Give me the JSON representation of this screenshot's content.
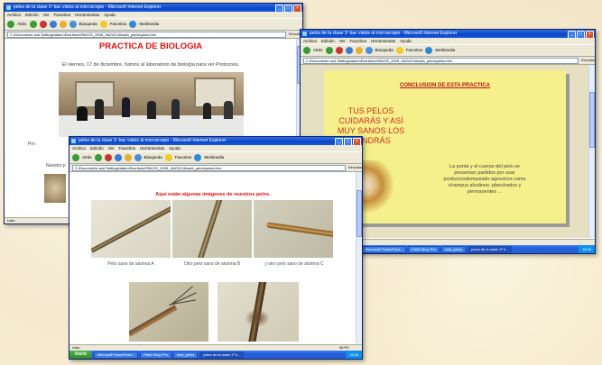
{
  "menu_items": [
    "Archivo",
    "Edición",
    "Ver",
    "Favoritos",
    "Herramientas",
    "Ayuda"
  ],
  "toolbar": {
    "back": "Atrás",
    "search": "Búsqueda",
    "favorites": "Favoritos",
    "multimedia": "Multimedia",
    "links": "Vínculos"
  },
  "win1": {
    "title": "pelos de la clase 1º bac vistos al microscopio - Microsoft Internet Explorer",
    "address": "C:\\Documents and Settings\\dalen\\Escritorio\\PAKOS_2005_VAZ\\SCIA\\web_pelos\\pelos.htm",
    "heading": "PRACTICA DE BIOLOGIA",
    "intro": "El viernes, 17 de diciembre, fuimos al laboratorio de biologia para ver Protozoos.",
    "para_fragment": "Pro",
    "para_fragment2": "Nuestro p",
    "status": "Listo"
  },
  "win2": {
    "title": "pelos de la clase 1º bac vistos al microscopio - Microsoft Internet Explorer",
    "address": "C:\\Documents and Settings\\dalen\\Escritorio\\PAKOS_2005_VAZ\\SCIA\\web_pelos\\pelos.htm",
    "section_title": "CONCLUSION DE ESTA PRACTICA",
    "big_text": "TUS PELOS CUIDARÁS Y ASÍ MUY SANOS LOS TENDRÁS",
    "body_text": "La punta y el cuerpo del pelo se presentan partidos por usar productosdemasiado agresivos como champus alcalinos. planchados y permanentes ...",
    "status": "Mi PC",
    "tasks": [
      "Microsoft PowerPoint...",
      "Paint Shop Pro",
      "web_pelos",
      "pelos de la clase 1º b..."
    ],
    "clock": "16:05"
  },
  "win3": {
    "title": "pelos de la clase 1º bac vistos al microscopio - Microsoft Internet Explorer",
    "address": "C:\\Documents and Settings\\dalen\\Escritorio\\PAKOS_2005_VAZ\\SCIA\\web_pelos\\pelos.htm",
    "caption": "Aquí están algunas imágenes de nuestros pelos.",
    "labels": [
      "Pelo sano de alumna A",
      "Otro pelo sano de alumna B",
      "y otro pelo sano de alumna C"
    ],
    "status": "Listo",
    "statusright": "Mi PC",
    "start": "Inicio",
    "tasks": [
      "Microsoft PowerPoint...",
      "Paint Shop Pro",
      "web_pelos",
      "pelos de la clase 1º b..."
    ],
    "clock": "16:05"
  },
  "colors": {
    "title_red": "#e01010",
    "yellow_bg": "#f5f08c",
    "xp_blue": "#245edb"
  }
}
